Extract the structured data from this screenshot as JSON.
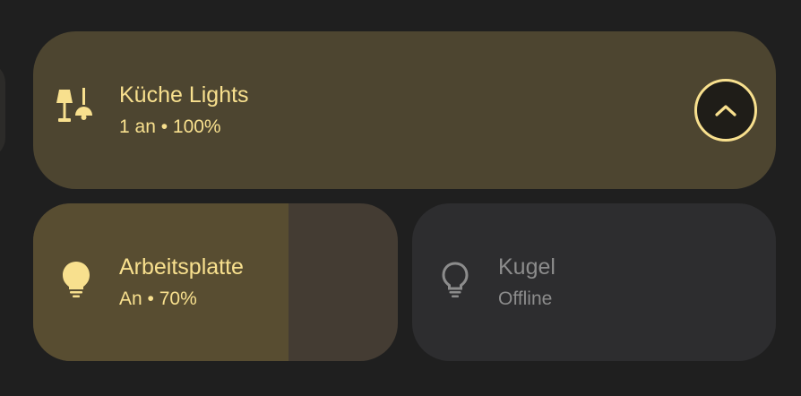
{
  "group_tile": {
    "title": "Küche Lights",
    "status": "1 an • 100%",
    "icon": "lamp-group-icon",
    "toggle_icon": "chevron-up-icon"
  },
  "lights": [
    {
      "title": "Arbeitsplatte",
      "status": "An • 70%",
      "icon": "lightbulb-on-icon",
      "brightness_percent": 70
    },
    {
      "title": "Kugel",
      "status": "Offline",
      "icon": "lightbulb-outline-icon"
    }
  ],
  "colors": {
    "accent": "#f8e08e",
    "background": "#1f1f1f",
    "group_tile": "#4d4530",
    "light_fill": "#584d31",
    "light_track": "#443c33",
    "offline_tile": "#2d2d2f",
    "offline_text": "#8c8c8c"
  }
}
